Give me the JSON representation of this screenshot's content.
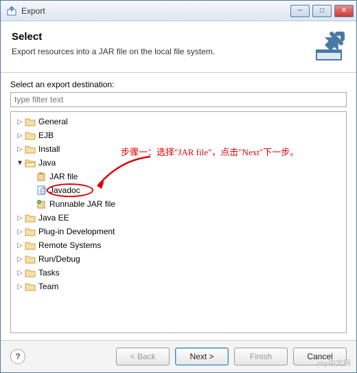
{
  "titlebar": {
    "title": "Export"
  },
  "header": {
    "title": "Select",
    "subtitle": "Export resources into a JAR file on the local file system."
  },
  "body": {
    "dest_label": "Select an export destination:",
    "filter_placeholder": "type filter text"
  },
  "tree": {
    "items": [
      {
        "label": "General",
        "expanded": false
      },
      {
        "label": "EJB",
        "expanded": false
      },
      {
        "label": "Install",
        "expanded": false
      },
      {
        "label": "Java",
        "expanded": true,
        "children": [
          {
            "label": "JAR file",
            "icon": "jar"
          },
          {
            "label": "Javadoc",
            "icon": "javadoc"
          },
          {
            "label": "Runnable JAR file",
            "icon": "runjar"
          }
        ]
      },
      {
        "label": "Java EE",
        "expanded": false
      },
      {
        "label": "Plug-in Development",
        "expanded": false
      },
      {
        "label": "Remote Systems",
        "expanded": false
      },
      {
        "label": "Run/Debug",
        "expanded": false
      },
      {
        "label": "Tasks",
        "expanded": false
      },
      {
        "label": "Team",
        "expanded": false
      }
    ]
  },
  "annotation": {
    "text": "步骤一：选择\"JAR file\"，点击\"Next\"下一步。"
  },
  "footer": {
    "back": "< Back",
    "next": "Next >",
    "finish": "Finish",
    "cancel": "Cancel"
  },
  "watermark": "php中文网"
}
